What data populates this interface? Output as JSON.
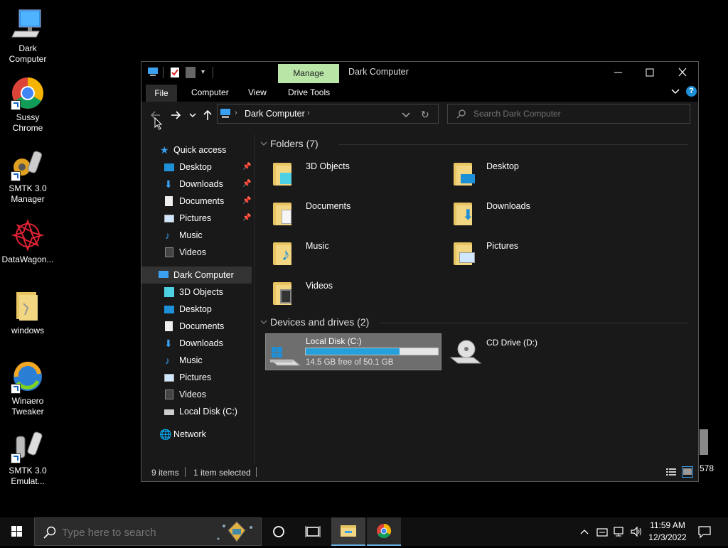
{
  "desktop": {
    "icons": [
      {
        "label": "Dark Computer",
        "icon": "computer-icon"
      },
      {
        "label": "Sussy Chrome",
        "icon": "chrome-icon"
      },
      {
        "label": "SMTK 3.0 Manager",
        "icon": "smtk-manager-icon"
      },
      {
        "label": "DataWagon...",
        "icon": "datawagon-icon"
      },
      {
        "label": "windows",
        "icon": "folder-icon"
      },
      {
        "label": "Winaero Tweaker",
        "icon": "winaero-icon"
      },
      {
        "label": "SMTK 3.0 Emulat...",
        "icon": "smtk-emulator-icon"
      }
    ],
    "partial_right_label": "578"
  },
  "window": {
    "title": "Dark Computer",
    "manage_tab": "Manage",
    "ribbon_tabs": [
      "File",
      "Computer",
      "View",
      "Drive Tools"
    ],
    "breadcrumb": "Dark Computer",
    "search_placeholder": "Search Dark Computer",
    "nav": {
      "quick_access": "Quick access",
      "quick_items": [
        "Desktop",
        "Downloads",
        "Documents",
        "Pictures",
        "Music",
        "Videos"
      ],
      "this_pc": "Dark Computer",
      "pc_items": [
        "3D Objects",
        "Desktop",
        "Documents",
        "Downloads",
        "Music",
        "Pictures",
        "Videos",
        "Local Disk (C:)"
      ],
      "network": "Network"
    },
    "folders_header": "Folders (7)",
    "folders": [
      "3D Objects",
      "Desktop",
      "Documents",
      "Downloads",
      "Music",
      "Pictures",
      "Videos"
    ],
    "devices_header": "Devices and drives (2)",
    "drives": [
      {
        "name": "Local Disk (C:)",
        "free": "14.5 GB free of 50.1 GB",
        "used_fraction": 0.71
      },
      {
        "name": "CD Drive (D:)"
      }
    ],
    "status": {
      "items": "9 items",
      "selected": "1 item selected"
    }
  },
  "taskbar": {
    "search_placeholder": "Type here to search",
    "time": "11:59 AM",
    "date": "12/3/2022"
  },
  "colors": {
    "accent": "#1e90d8",
    "manage_tab": "#b9e5a7",
    "selected_drive": "#6e6e6e"
  }
}
